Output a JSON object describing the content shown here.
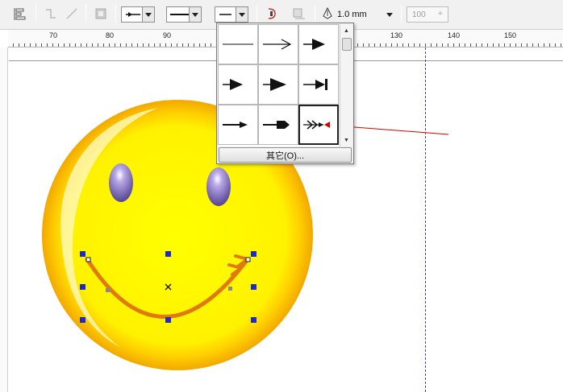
{
  "toolbar": {
    "outline_width": "1.0 mm",
    "number_field": "100"
  },
  "ruler": {
    "labels": [
      "70",
      "80",
      "90",
      "130",
      "140",
      "150"
    ]
  },
  "arrow_popup": {
    "cells": [
      "line-no-arrow",
      "open-arrow",
      "filled-triangle-arrow",
      "small-filled-arrow",
      "large-filled-arrow",
      "arrow-to-bar",
      "thin-arrow",
      "square-tail-arrow",
      "feather-arrow"
    ],
    "selected_index": 0,
    "highlighted_index": 8,
    "other_button_label": "其它(O)..."
  },
  "colors": {
    "face_yellow": "#ffea00",
    "face_orange": "#f5a800",
    "eye_purple": "#6b5aa8",
    "smile_orange": "#e07a0c",
    "selection_handle": "#1c2bc4",
    "guide_blue": "#3a3ad0",
    "annotation_red": "#d40000"
  }
}
